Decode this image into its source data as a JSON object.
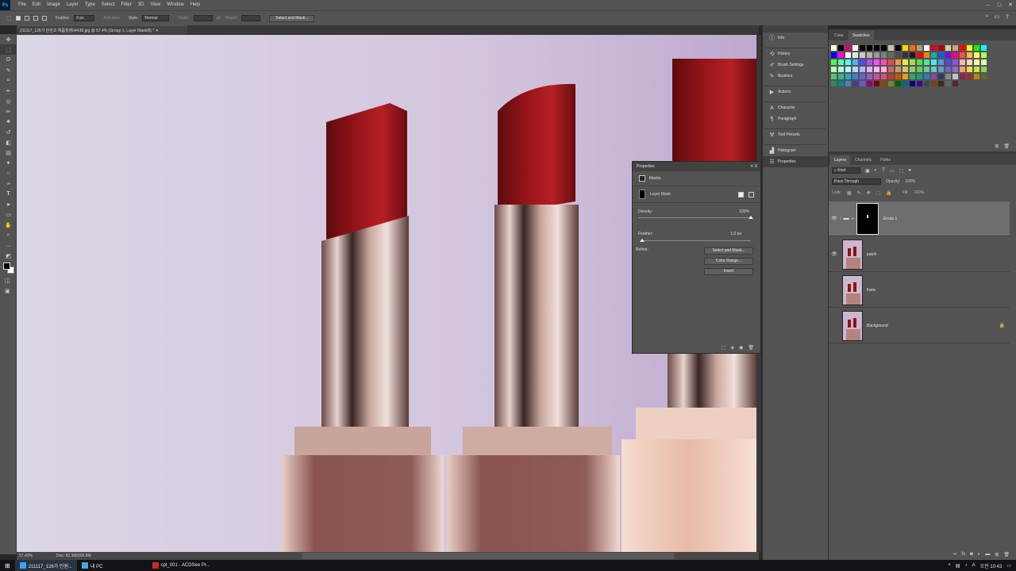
{
  "menu": [
    "File",
    "Edit",
    "Image",
    "Layer",
    "Type",
    "Select",
    "Filter",
    "3D",
    "View",
    "Window",
    "Help"
  ],
  "logo": "Ps",
  "options": {
    "feather_label": "Feather:",
    "feather_value": "0 px",
    "antialias_label": "Anti-alias",
    "style_label": "Style:",
    "style_value": "Normal",
    "width_label": "Width:",
    "height_label": "Height:",
    "select_mask_btn": "Select and Mask..."
  },
  "document": {
    "tab_title": "211117_126가 민원조 예품촬영04438.jpg @ 57.4% (Group 1, Layer Mask/8) *",
    "zoom": "57.43%",
    "doc_size": "Doc: 82.3M/306.8M"
  },
  "dock": [
    "Info",
    "History",
    "Brush Settings",
    "Brushes",
    "Actions",
    "Character",
    "Paragraph",
    "Tool Presets",
    "Histogram",
    "Properties"
  ],
  "properties": {
    "title": "Properties",
    "section": "Masks",
    "mask_type": "Layer Mask",
    "density_label": "Density:",
    "density_value": "100%",
    "density": 1.0,
    "feather_label": "Feather:",
    "feather_value": "1.0 px",
    "feather": 0.0,
    "refine_label": "Refine:",
    "buttons": [
      "Select and Mask...",
      "Color Range...",
      "Invert"
    ]
  },
  "color_panel": {
    "tabs": [
      "Color",
      "Swatches"
    ],
    "swatches": [
      "#ffffff",
      "#000000",
      "#e3007e",
      "#ffffff",
      "#000000",
      "#000000",
      "#000000",
      "#000000",
      "#d5c0a3",
      "#000000",
      "#ffd800",
      "#ff6a00",
      "#b39b72",
      "#ffffff",
      "#e0001a",
      "#b30010",
      "#e2c8a6",
      "#cda27c",
      "#ff0000",
      "#ffff00",
      "#00ff00",
      "#00ffff",
      "#0000ff",
      "#ff00ff",
      "#ffffff",
      "#e6e6e6",
      "#cccccc",
      "#b3b3b3",
      "#999999",
      "#808080",
      "#666666",
      "#4d4d4d",
      "#333333",
      "#1a1a1a",
      "#ff0000",
      "#ff8000",
      "#00b3b3",
      "#0066cc",
      "#8000ff",
      "#ff0080",
      "#ff4d4d",
      "#ffb84d",
      "#ffff66",
      "#b3ff4d",
      "#4dff4d",
      "#4dffb3",
      "#4dffff",
      "#4db3ff",
      "#4d4dff",
      "#b34dff",
      "#ff4dff",
      "#ff4db3",
      "#e64c4c",
      "#e6994c",
      "#e6e64c",
      "#99e64c",
      "#4ce64c",
      "#4ce699",
      "#4ce6e6",
      "#4c99e6",
      "#4c4ce6",
      "#994ce6",
      "#ffb3b3",
      "#ffd9b3",
      "#ffffb3",
      "#d9ffb3",
      "#b3ffb3",
      "#b3ffd9",
      "#b3ffff",
      "#b3d9ff",
      "#b3b3ff",
      "#d9b3ff",
      "#ffb3ff",
      "#ffb3d9",
      "#cc6666",
      "#cc9966",
      "#cccc66",
      "#99cc66",
      "#66cc66",
      "#66cc99",
      "#66cccc",
      "#6699cc",
      "#6666cc",
      "#9966cc",
      "#f7a35c",
      "#f2d94c",
      "#c6e24c",
      "#8fd14f",
      "#4fc471",
      "#39b29a",
      "#2ea3c7",
      "#3b80d6",
      "#6a5fd1",
      "#9b59c4",
      "#c94fa6",
      "#e04d74",
      "#c0392b",
      "#d35400",
      "#f39c12",
      "#27ae60",
      "#16a085",
      "#2980b9",
      "#8e44ad",
      "#2c3e50",
      "#7f8c8d",
      "#bdc3c7",
      "#8b2252",
      "#a52a2a",
      "#b8860b",
      "#556b2f",
      "#2e8b57",
      "#008b8b",
      "#4682b4",
      "#483d8b",
      "#6a5acd",
      "#8b008b",
      "#800000",
      "#8b4513",
      "#6b8e23",
      "#006400",
      "#00688b",
      "#000080",
      "#4b0082",
      "#2f4f4f",
      "#704214",
      "#3d2b1f",
      "#556b5f",
      "#5e2129"
    ]
  },
  "layers_panel": {
    "tabs": [
      "Layers",
      "Channels",
      "Paths"
    ],
    "filter": "Kind",
    "blend_mode": "Pass Through",
    "opacity_label": "Opacity:",
    "opacity_value": "100%",
    "lock_label": "Lock:",
    "fill_label": "Fill:",
    "fill_value": "100%",
    "layers": [
      {
        "name": "Group 1",
        "visible": true,
        "selected": true
      },
      {
        "name": "patch",
        "visible": true,
        "selected": false
      },
      {
        "name": "frans",
        "visible": false,
        "selected": false
      },
      {
        "name": "Background",
        "visible": false,
        "selected": false
      }
    ]
  },
  "taskbar": {
    "items": [
      "211117_126가 민원...",
      "내 PC",
      "cpt_001 - ACDSee Pr..."
    ],
    "time": "오전 10:43"
  },
  "colors": {
    "ui_dark": "#535353",
    "lipstick_red": "#8e1414",
    "accent_blue": "#31a8ff"
  }
}
